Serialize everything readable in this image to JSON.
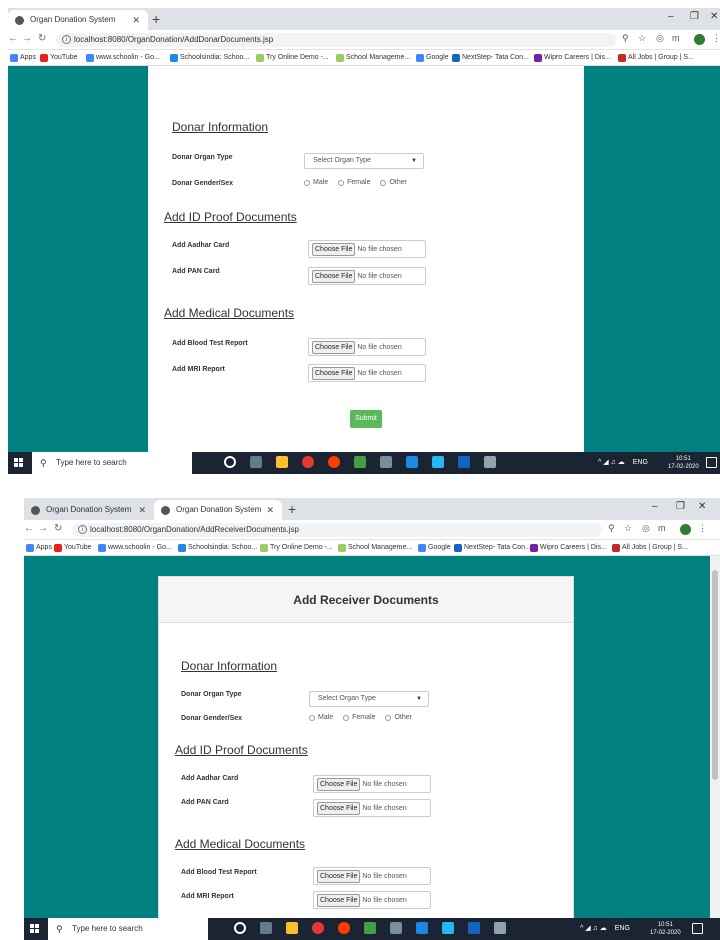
{
  "screens": [
    {
      "tabs": [
        {
          "label": "Organ Donation System",
          "active": true
        }
      ],
      "url": "localhost:8080/OrganDonation/AddDonarDocuments.jsp",
      "card_title": "",
      "sections": {
        "donar_info": "Donar Information",
        "id_proof": "Add ID Proof Documents",
        "medical": "Add Medical Documents"
      },
      "fields": {
        "organ_type_label": "Donar Organ Type",
        "organ_type_placeholder": "Select Organ Type",
        "gender_label": "Donar Gender/Sex",
        "aadhar_label": "Add Aadhar Card",
        "pan_label": "Add PAN Card",
        "blood_label": "Add Blood Test Report",
        "mri_label": "Add MRI Report"
      },
      "submit_label": "Submit",
      "clock_time": "10:51",
      "clock_date": "17-02-2020"
    },
    {
      "tabs": [
        {
          "label": "Organ Donation System",
          "active": false
        },
        {
          "label": "Organ Donation System",
          "active": true
        }
      ],
      "url": "localhost:8080/OrganDonation/AddReceiverDocuments.jsp",
      "card_title": "Add Receiver Documents",
      "sections": {
        "donar_info": "Donar Information",
        "id_proof": "Add ID Proof Documents",
        "medical": "Add Medical Documents"
      },
      "fields": {
        "organ_type_label": "Donar Organ Type",
        "organ_type_placeholder": "Select Organ Type",
        "gender_label": "Donar Gender/Sex",
        "aadhar_label": "Add Aadhar Card",
        "pan_label": "Add PAN Card",
        "blood_label": "Add Blood Test Report",
        "mri_label": "Add MRI Report"
      },
      "submit_label": "",
      "clock_time": "10:51",
      "clock_date": "17-02-2020"
    }
  ],
  "common": {
    "gender_options": [
      "Male",
      "Female",
      "Other"
    ],
    "choose_file_label": "Choose File",
    "no_file_label": "No file chosen",
    "bookmarks": [
      "Apps",
      "YouTube",
      "www.schoolin - Go...",
      "Schoolsindia: Schoo...",
      "Try Online Demo -...",
      "School Manageme...",
      "Google",
      "NextStep- Tata Con...",
      "Wipro Careers | Dis...",
      "All Jobs | Group | S..."
    ],
    "taskbar_search": "Type here to search",
    "tray_lang": "ENG",
    "colors": {
      "page_bg": "#008080",
      "submit": "#5cb85c",
      "taskbar": "#1b2433"
    }
  }
}
